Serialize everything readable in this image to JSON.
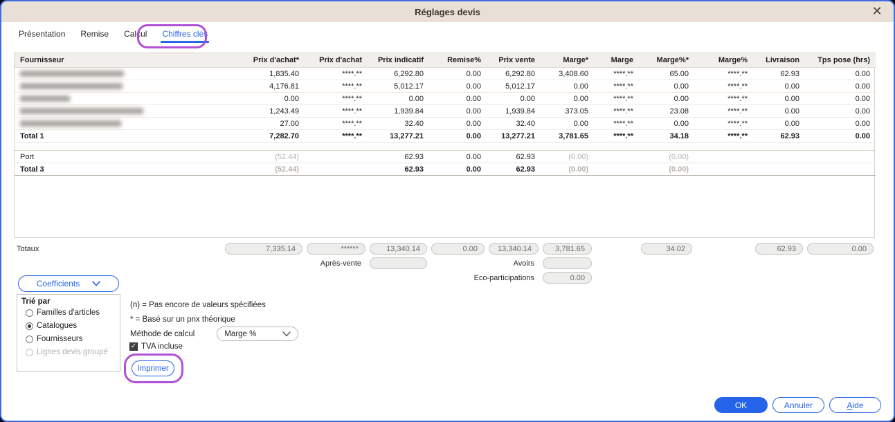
{
  "window": {
    "title": "Réglages devis",
    "close_icon": "✕"
  },
  "tabs": [
    {
      "label": "Présentation",
      "active": false
    },
    {
      "label": "Remise",
      "active": false
    },
    {
      "label": "Calcul",
      "active": false
    },
    {
      "label": "Chiffres clés",
      "active": true,
      "annotated": true
    }
  ],
  "table": {
    "columns": [
      "Fournisseur",
      "Prix d'achat*",
      "Prix d'achat",
      "Prix indicatif",
      "Remise%",
      "Prix vente",
      "Marge*",
      "Marge",
      "Marge%*",
      "Marge%",
      "Livraison",
      "Tps pose (hrs)"
    ],
    "rows": [
      {
        "supplier_redacted": true,
        "blur_width": 150,
        "values": [
          "1,835.40",
          "****.**",
          "6,292.80",
          "0.00",
          "6,292.80",
          "3,408.60",
          "****.**",
          "65.00",
          "****.**",
          "62.93",
          "0.00"
        ]
      },
      {
        "supplier_redacted": true,
        "blur_width": 148,
        "values": [
          "4,176.81",
          "****.**",
          "5,012.17",
          "0.00",
          "5,012.17",
          "0.00",
          "****.**",
          "0.00",
          "****.**",
          "0.00",
          "0.00"
        ]
      },
      {
        "supplier_redacted": true,
        "blur_width": 72,
        "values": [
          "0.00",
          "****.**",
          "0.00",
          "0.00",
          "0.00",
          "0.00",
          "****.**",
          "0.00",
          "****.**",
          "0.00",
          "0.00"
        ]
      },
      {
        "supplier_redacted": true,
        "blur_width": 178,
        "values": [
          "1,243.49",
          "****.**",
          "1,939.84",
          "0.00",
          "1,939.84",
          "373.05",
          "****.**",
          "23.08",
          "****.**",
          "0.00",
          "0.00"
        ]
      },
      {
        "supplier_redacted": true,
        "blur_width": 146,
        "values": [
          "27.00",
          "****.**",
          "32.40",
          "0.00",
          "32.40",
          "0.00",
          "****.**",
          "0.00",
          "****.**",
          "0.00",
          "0.00"
        ]
      }
    ],
    "total1": {
      "label": "Total 1",
      "values": [
        "7,282.70",
        "****.**",
        "13,277.21",
        "0.00",
        "13,277.21",
        "3,781.65",
        "****.**",
        "34.18",
        "****.**",
        "62.93",
        "0.00"
      ]
    },
    "port": {
      "label": "Port",
      "values": [
        "(52.44)",
        "",
        "62.93",
        "0.00",
        "62.93",
        "(0.00)",
        "",
        "(0.00)",
        "",
        "",
        ""
      ]
    },
    "total3": {
      "label": "Total 3",
      "values": [
        "(52.44)",
        "",
        "62.93",
        "0.00",
        "62.93",
        "(0.00)",
        "",
        "(0.00)",
        "",
        "",
        ""
      ]
    }
  },
  "totals": {
    "label": "Totaux",
    "pills_row1": [
      {
        "col": 2,
        "value": "7,335.14"
      },
      {
        "col": 3,
        "value": "******"
      },
      {
        "col": 4,
        "value": "13,340.14"
      },
      {
        "col": 5,
        "value": "0.00"
      },
      {
        "col": 6,
        "value": "13,340.14"
      },
      {
        "col": 7,
        "value": "3,781.65"
      },
      {
        "col": 9,
        "value": "34.02"
      },
      {
        "col": 11,
        "value": "62.93"
      },
      {
        "col": 12,
        "value": "0.00"
      }
    ],
    "apres_vente": {
      "label": "Après-vente",
      "value": "",
      "col": 4
    },
    "avoirs": {
      "label": "Avoirs",
      "value": "",
      "col": 7
    },
    "eco": {
      "label": "Eco-participations",
      "value": "0.00",
      "col": 7
    }
  },
  "coefficients_button": {
    "label": "Coefficients"
  },
  "sort_group": {
    "title": "Trié par",
    "options": [
      {
        "label": "Familles d'articles",
        "selected": false,
        "disabled": false
      },
      {
        "label": "Catalogues",
        "selected": true,
        "disabled": false
      },
      {
        "label": "Fournisseurs",
        "selected": false,
        "disabled": false
      },
      {
        "label": "Lignes devis groupé",
        "selected": false,
        "disabled": true
      }
    ]
  },
  "notes": [
    "(n) = Pas encore de valeurs spécifiées",
    "* = Basé sur un prix théorique"
  ],
  "method": {
    "label": "Méthode de calcul",
    "value": "Marge %"
  },
  "tva_checkbox": {
    "label": "TVA incluse",
    "checked": true,
    "check_glyph": "✓"
  },
  "imprimer_button": {
    "label": "Imprimer"
  },
  "footer_buttons": {
    "ok": "OK",
    "cancel": "Annuler",
    "help": "Aide"
  },
  "colors": {
    "accent": "#2563eb",
    "annotation": "#b14fd6",
    "titlebar": "#e8dfd7",
    "muted_value": "#b5b2ae"
  }
}
